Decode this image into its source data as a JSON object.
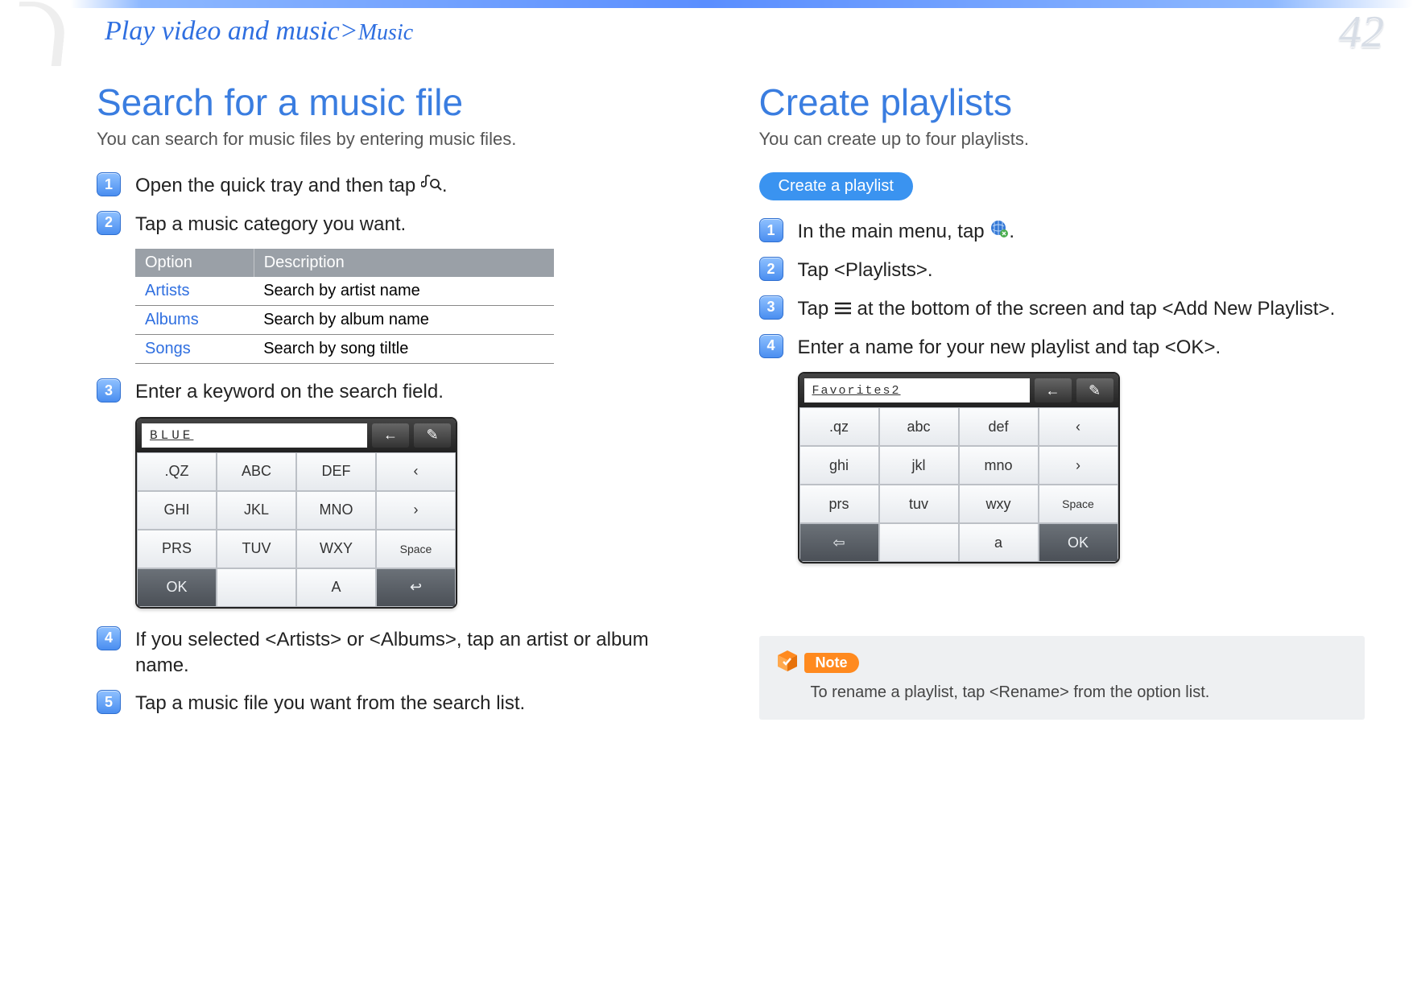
{
  "page_number": "42",
  "breadcrumb": {
    "part1": "Play video and music",
    "sep": ">",
    "part2": "Music"
  },
  "left": {
    "heading": "Search for a music file",
    "lead": "You can search for music files by entering music files.",
    "steps": {
      "s1_a": "Open the quick tray and then tap ",
      "s1_b": ".",
      "s2": "Tap a music category you want.",
      "s3": "Enter a keyword on the search field.",
      "s4": "If you selected <Artists> or <Albums>, tap an artist or album name.",
      "s5": "Tap a music file you want from the search list."
    },
    "table": {
      "head_option": "Option",
      "head_desc": "Description",
      "rows": [
        {
          "opt": "Artists",
          "desc": "Search by artist name"
        },
        {
          "opt": "Albums",
          "desc": "Search by album name"
        },
        {
          "opt": "Songs",
          "desc": "Search by song tiltle"
        }
      ]
    },
    "keypad": {
      "input_value": "BLUE",
      "back_arrow": "←",
      "edit": "✎",
      "keys": [
        ".QZ",
        "ABC",
        "DEF",
        "‹",
        "GHI",
        "JKL",
        "MNO",
        "›",
        "PRS",
        "TUV",
        "WXY",
        "Space",
        "OK",
        "",
        "A",
        "↩"
      ],
      "dark_indices": [
        12,
        15
      ]
    }
  },
  "right": {
    "heading": "Create playlists",
    "lead": "You can create up to four playlists.",
    "pill": "Create a playlist",
    "steps": {
      "s1_a": "In the main menu, tap ",
      "s1_b": ".",
      "s2": "Tap <Playlists>.",
      "s3_a": "Tap ",
      "s3_b": " at the bottom of the screen and tap <Add New Playlist>.",
      "s4": "Enter a name for your new playlist and tap <OK>."
    },
    "keypad": {
      "input_value": "Favorites2",
      "back_arrow": "←",
      "edit": "✎",
      "keys": [
        ".qz",
        "abc",
        "def",
        "‹",
        "ghi",
        "jkl",
        "mno",
        "›",
        "prs",
        "tuv",
        "wxy",
        "Space",
        "⇦",
        "",
        "a",
        "OK"
      ],
      "dark_indices": [
        12,
        15
      ]
    },
    "note_label": "Note",
    "note_body": "To rename a playlist, tap <Rename> from the option list."
  },
  "icons": {
    "music_search": "music-search-icon",
    "globe": "globe-icon",
    "menu": "menu-icon",
    "note_cube": "note-cube-icon"
  }
}
